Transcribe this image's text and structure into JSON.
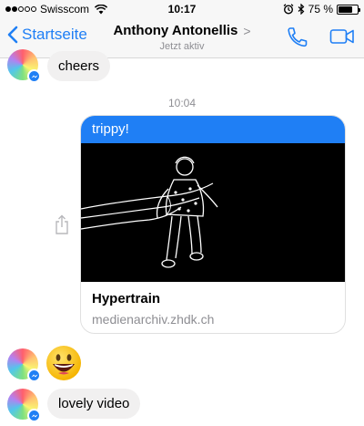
{
  "status_bar": {
    "carrier": "Swisscom",
    "time": "10:17",
    "battery": "75 %",
    "battery_level_percent": 75
  },
  "nav": {
    "back_label": "Startseite",
    "title": "Anthony Antonellis",
    "title_chevron": ">",
    "subtitle": "Jetzt aktiv"
  },
  "messages": {
    "first_text": "cheers",
    "timestamp": "10:04",
    "link_card": {
      "caption": "trippy!",
      "title": "Hypertrain",
      "domain": "medienarchiv.zhdk.ch"
    },
    "emoji_name": "grinning-face-emoji",
    "last_text": "lovely video"
  },
  "colors": {
    "accent": "#1f7ff5",
    "bubble_in": "#f1f0f0",
    "muted_text": "#8e8e93"
  }
}
